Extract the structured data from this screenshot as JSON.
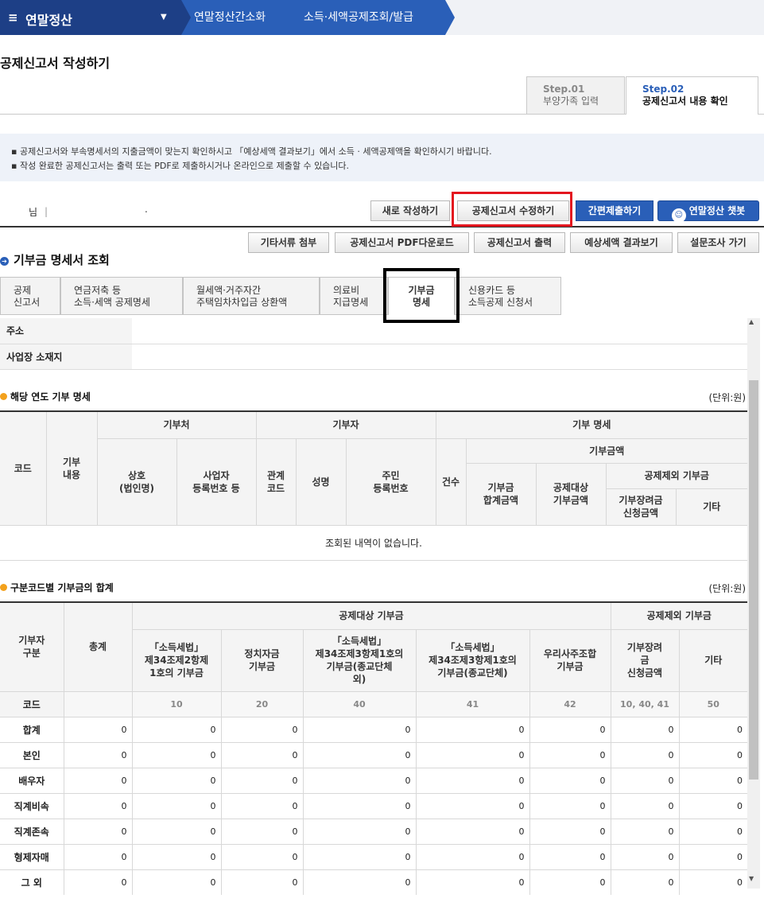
{
  "nav": {
    "menu_icon": "menu-icon",
    "title": "연말정산",
    "crumb1": "연말정산간소화",
    "crumb2": "소득·세액공제조회/발급"
  },
  "page_title": "공제신고서 작성하기",
  "steps": [
    {
      "num": "Step.01",
      "label": "부양가족 입력"
    },
    {
      "num": "Step.02",
      "label": "공제신고서 내용 확인"
    }
  ],
  "notice": [
    "공제신고서와 부속명세서의 지출금액이 맞는지 확인하시고 「예상세액 결과보기」에서 소득 · 세액공제액을 확인하시기 바랍니다.",
    "작성 완료한 공제신고서는 출력 또는 PDF로 제출하시거나 온라인으로 제출할 수 있습니다."
  ],
  "user": {
    "suffix": "님",
    "bar": "|",
    "dot": "."
  },
  "actions": {
    "new": "새로 작성하기",
    "edit": "공제신고서 수정하기",
    "simple_submit": "간편제출하기",
    "chatbot": "연말정산 챗봇",
    "attach": "기타서류 첨부",
    "pdf": "공제신고서 PDF다운로드",
    "print": "공제신고서 출력",
    "estimate": "예상세액 결과보기",
    "survey": "설문조사 가기"
  },
  "section_title": "기부금 명세서 조회",
  "tabs": [
    {
      "l1": "공제",
      "l2": "신고서"
    },
    {
      "l1": "연금저축 등",
      "l2": "소득·세액 공제명세"
    },
    {
      "l1": "월세액·거주자간",
      "l2": "주택임차차입금 상환액"
    },
    {
      "l1": "의료비",
      "l2": "지급명세"
    },
    {
      "l1": "기부금",
      "l2": "명세"
    },
    {
      "l1": "신용카드 등",
      "l2": "소득공제 신청서"
    }
  ],
  "address": {
    "addr_label": "주소",
    "site_label": "사업장 소재지"
  },
  "detail": {
    "title": "해당 연도 기부 명세",
    "unit": "(단위:원)",
    "headers": {
      "code": "코드",
      "content": "기부\n내용",
      "donee": "기부처",
      "donor": "기부자",
      "donation": "기부 명세",
      "name": "상호\n(법인명)",
      "biz_no": "사업자\n등록번호 등",
      "rel": "관계\n코드",
      "person": "성명",
      "rrn": "주민\n등록번호",
      "count": "건수",
      "amount": "기부금액",
      "total": "기부금\n합계금액",
      "deductible": "공제대상\n기부금액",
      "excluded": "공제제외 기부금",
      "scholarship": "기부장려금\n신청금액",
      "other": "기타"
    },
    "empty": "조회된 내역이 없습니다."
  },
  "summary": {
    "title": "구분코드별 기부금의 합계",
    "unit": "(단위:원)",
    "headers": {
      "type": "기부자\n구분",
      "sum": "총계",
      "deductible": "공제대상 기부금",
      "excluded": "공제제외 기부금",
      "c1": "「소득세법」\n제34조제2항제\n1호의 기부금",
      "c2": "정치자금\n기부금",
      "c3": "「소득세법」\n제34조제3항제1호의\n기부금(종교단체\n외)",
      "c4": "「소득세법」\n제34조제3항제1호의\n기부금(종교단체)",
      "c5": "우리사주조합\n기부금",
      "c6": "기부장려\n금\n신청금액",
      "c7": "기타"
    },
    "code_row": {
      "label": "코드",
      "codes": [
        "",
        "10",
        "20",
        "40",
        "41",
        "42",
        "10, 40, 41",
        "50"
      ]
    },
    "rows": [
      {
        "label": "합계",
        "values": [
          "0",
          "0",
          "0",
          "0",
          "0",
          "0",
          "0",
          "0"
        ]
      },
      {
        "label": "본인",
        "values": [
          "0",
          "0",
          "0",
          "0",
          "0",
          "0",
          "0",
          "0"
        ]
      },
      {
        "label": "배우자",
        "values": [
          "0",
          "0",
          "0",
          "0",
          "0",
          "0",
          "0",
          "0"
        ]
      },
      {
        "label": "직계비속",
        "values": [
          "0",
          "0",
          "0",
          "0",
          "0",
          "0",
          "0",
          "0"
        ]
      },
      {
        "label": "직계존속",
        "values": [
          "0",
          "0",
          "0",
          "0",
          "0",
          "0",
          "0",
          "0"
        ]
      },
      {
        "label": "형제자매",
        "values": [
          "0",
          "0",
          "0",
          "0",
          "0",
          "0",
          "0",
          "0"
        ]
      },
      {
        "label": "그 외",
        "values": [
          "0",
          "0",
          "0",
          "0",
          "0",
          "0",
          "0",
          "0"
        ]
      }
    ]
  }
}
